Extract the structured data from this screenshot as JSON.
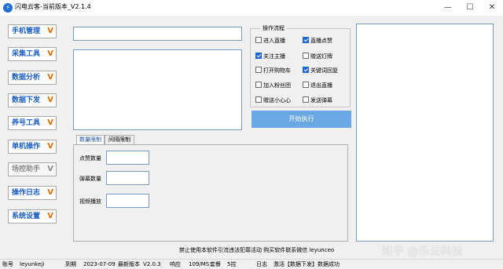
{
  "window": {
    "icon_glyph": "⚡",
    "title": "闪电云客-当前版本_V2.1.4",
    "minimize": "—",
    "maximize": "☐",
    "close": "✕"
  },
  "sidebar": {
    "items": [
      {
        "label": "手机管理",
        "chev": "V"
      },
      {
        "label": "采集工具",
        "chev": "V"
      },
      {
        "label": "数据分析",
        "chev": "V"
      },
      {
        "label": "数据下发",
        "chev": "V"
      },
      {
        "label": "养号工具",
        "chev": "V"
      },
      {
        "label": "单机操作",
        "chev": "V"
      },
      {
        "label": "场控助手",
        "chev": "V"
      },
      {
        "label": "操作日志",
        "chev": "V"
      },
      {
        "label": "系统设置",
        "chev": "V"
      }
    ]
  },
  "main": {
    "top_input_value": "",
    "textarea_value": ""
  },
  "flow": {
    "title": "操作流程",
    "options": [
      {
        "label": "进入直播",
        "checked": false
      },
      {
        "label": "直播点赞",
        "checked": true
      },
      {
        "label": "关注主播",
        "checked": true
      },
      {
        "label": "赠送灯牌",
        "checked": false
      },
      {
        "label": "打开购物车",
        "checked": false
      },
      {
        "label": "关键词回复",
        "checked": true
      },
      {
        "label": "加入粉丝团",
        "checked": false
      },
      {
        "label": "退出直播",
        "checked": false
      },
      {
        "label": "赠送小心心",
        "checked": false
      },
      {
        "label": "发送弹幕",
        "checked": false
      }
    ],
    "start_label": "开始执行"
  },
  "tabs": [
    {
      "label": "数量限制",
      "active": true
    },
    {
      "label": "间隔限制",
      "active": false
    }
  ],
  "fields": [
    {
      "label": "点赞数量",
      "value": ""
    },
    {
      "label": "弹幕数量",
      "value": ""
    },
    {
      "label": "视频播放",
      "value": ""
    }
  ],
  "notice": "禁止使用本软件引流违法犯罪活动 购买软件联系微信 leyunceo",
  "watermark": "知乎 @乐云科技",
  "status": {
    "account_label": "账号",
    "account": "leyunkeji",
    "expire_label": "到期",
    "expire": "2023-07-09",
    "latest_label": "最新版本",
    "latest": "V2.0.3",
    "latency_label": "响应",
    "latency": "109/MS",
    "plan_label": "套餐",
    "plan": "5控",
    "log_label": "日志",
    "log": "激活【数据下发】数据成功"
  },
  "colors": {
    "accent": "#1a5dc8",
    "chevron": "#e66a00",
    "start_button": "#6aa8e4",
    "checkbox_checked": "#1e66d6"
  }
}
